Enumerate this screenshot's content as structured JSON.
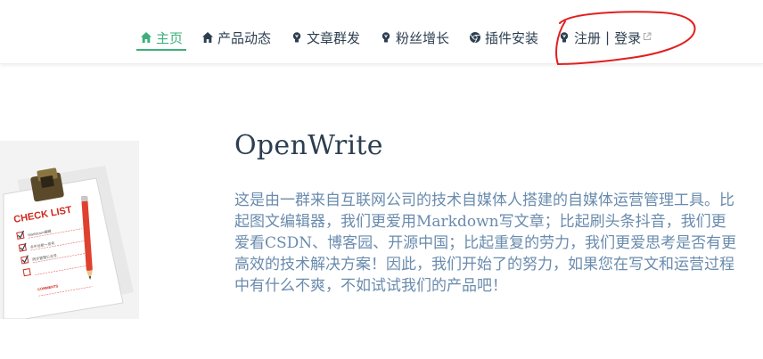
{
  "nav": {
    "home": "主页",
    "product_news": "产品动态",
    "article_distribution": "文章群发",
    "fan_growth": "粉丝增长",
    "plugin_install": "插件安装",
    "register": "注册",
    "separator": "|",
    "login": "登录"
  },
  "hero": {
    "title": "OpenWrite",
    "description": "这是由一群来自互联网公司的技术自媒体人搭建的自媒体运营管理工具。比起图文编辑器，我们更爱用Markdown写文章；比起刷头条抖音，我们更爱看CSDN、博客园、开源中国；比起重复的劳力，我们更爱思考是否有更高效的技术解决方案！因此，我们开始了的努力，如果您在写文和运营过程中有什么不爽，不如试试我们的产品吧！"
  },
  "image": {
    "heading": "CHECK LIST",
    "line1": "Markdown编辑",
    "line2": "多平台统一发布",
    "line3": "同步管理公众号",
    "footer": "COMMENTS"
  },
  "colors": {
    "accent": "#3eaf7c",
    "text": "#2c3e50",
    "description": "#6a8bad",
    "annotation": "#e0201e"
  },
  "icons": {
    "home": "home-icon",
    "product_news": "home-icon",
    "article_distribution": "bulb-icon",
    "fan_growth": "bulb-icon",
    "plugin_install": "chrome-icon",
    "register": "bulb-icon",
    "external": "external-link-icon"
  }
}
